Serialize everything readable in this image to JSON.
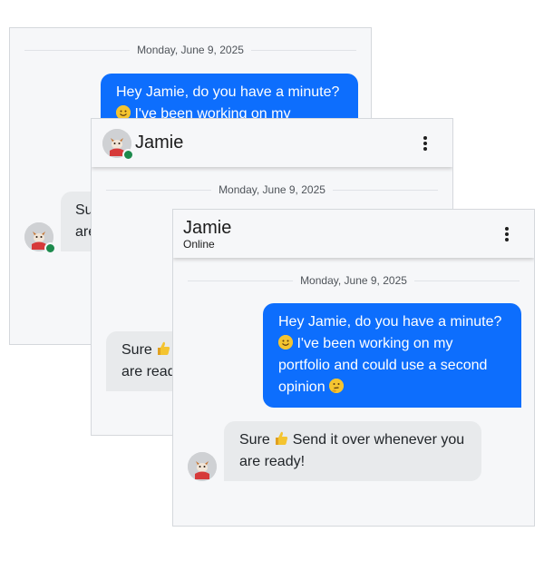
{
  "contact": {
    "name": "Jamie",
    "status": "Online"
  },
  "divider": {
    "date": "Monday, June 9, 2025"
  },
  "messages": {
    "outgoing": {
      "part1": "Hey Jamie, do you have a minute?",
      "part2": " I've been working on my",
      "part3": "portfolio and could use a second",
      "part4": "opinion",
      "emoji_1": "smiling-face-emoji",
      "emoji_2": "thinking-face-emoji"
    },
    "incoming": {
      "part1": "Sure",
      "part2": " Send it over whenever you",
      "part3": "are ready!",
      "emoji": "thumbs-up-emoji"
    },
    "win1_incoming": {
      "line1": "Su",
      "line2": "are"
    },
    "win2_incoming": {
      "line1": "Sure",
      "line2": "are read"
    }
  },
  "colors": {
    "outgoing_bubble": "#0d6efd",
    "incoming_bubble": "#e8eaec",
    "online_dot": "#1d8a4d",
    "background": "#f6f7f9"
  },
  "icons": {
    "menu": "kebab-menu-icon",
    "avatar": "corgi-avatar"
  }
}
